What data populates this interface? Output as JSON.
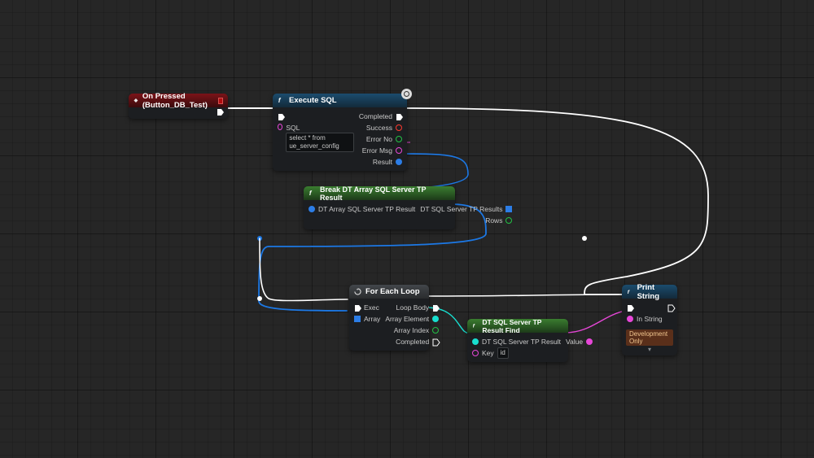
{
  "nodes": {
    "onPressed": {
      "title": "On Pressed (Button_DB_Test)"
    },
    "executeSql": {
      "title": "Execute SQL",
      "inputs": {
        "sql_label": "SQL",
        "sql_value": "select * from ue_server_config"
      },
      "outputs": {
        "completed": "Completed",
        "success": "Success",
        "errorNo": "Error No",
        "errorMsg": "Error Msg",
        "result": "Result"
      }
    },
    "breakDt": {
      "title": "Break DT Array SQL Server TP Result",
      "in_label": "DT Array SQL Server TP Result",
      "out_results": "DT SQL Server TP Results",
      "out_rows": "Rows"
    },
    "forEach": {
      "title": "For Each Loop",
      "in_exec": "Exec",
      "in_array": "Array",
      "out_loopBody": "Loop Body",
      "out_arrayElement": "Array Element",
      "out_arrayIndex": "Array Index",
      "out_completed": "Completed"
    },
    "find": {
      "title": "DT SQL Server TP Result Find",
      "in_result": "DT SQL Server TP Result",
      "in_key": "Key",
      "key_value": "id",
      "out_value": "Value"
    },
    "printString": {
      "title": "Print String",
      "in_string": "In String",
      "devonly": "Development Only"
    }
  }
}
